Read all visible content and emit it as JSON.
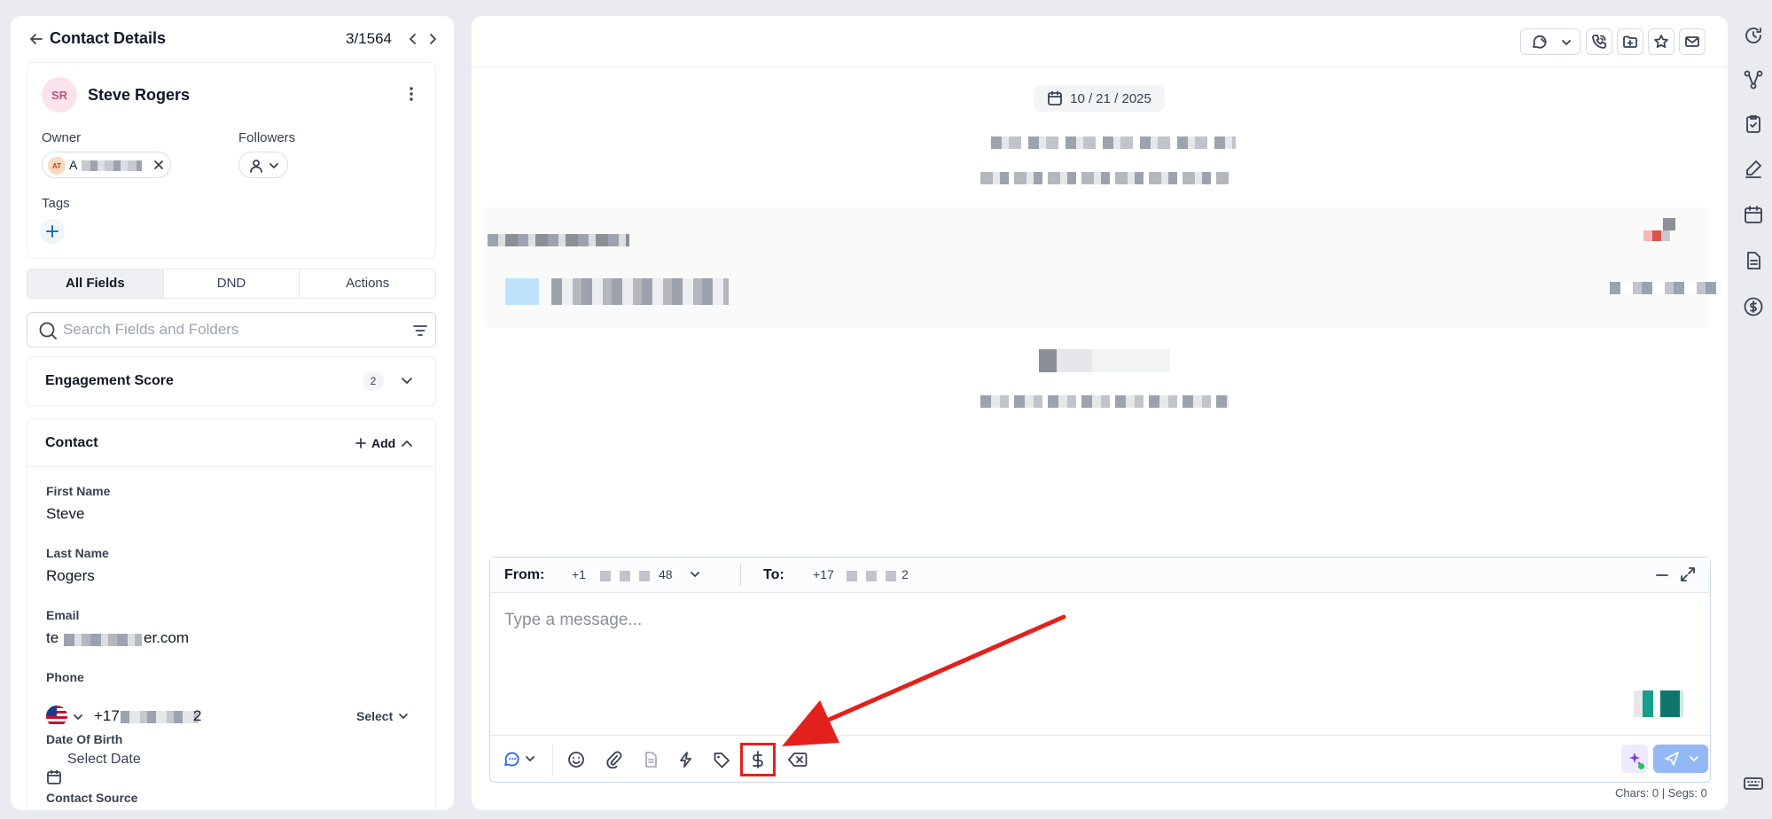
{
  "header": {
    "title": "Contact Details",
    "counter": "3/1564"
  },
  "contact": {
    "initials": "SR",
    "name": "Steve Rogers",
    "owner_label": "Owner",
    "owner_initials": "AT",
    "owner_name": "A",
    "followers_label": "Followers",
    "tags_label": "Tags"
  },
  "tabs": [
    "All Fields",
    "DND",
    "Actions"
  ],
  "search": {
    "placeholder": "Search Fields and Folders"
  },
  "engagement": {
    "title": "Engagement Score",
    "count": "2"
  },
  "contact_section": {
    "title": "Contact",
    "add_label": "Add",
    "first_name_label": "First Name",
    "first_name": "Steve",
    "last_name_label": "Last Name",
    "last_name": "Rogers",
    "email_label": "Email",
    "email_prefix": "te",
    "email_suffix": "er.com",
    "phone_label": "Phone",
    "phone_prefix": "+17",
    "phone_suffix": "2",
    "phone_type_label": "Select",
    "dob_label": "Date Of Birth",
    "dob_placeholder": "Select Date",
    "source_label": "Contact Source"
  },
  "conversation": {
    "date": "10 / 21 / 2025"
  },
  "composer": {
    "from_label": "From:",
    "from_prefix": "+1",
    "from_suffix": "48",
    "to_label": "To:",
    "to_prefix": "+17",
    "to_suffix": "2",
    "placeholder": "Type a message...",
    "counts": "Chars: 0 | Segs: 0"
  },
  "colors": {
    "annotation_red": "#e3211c",
    "send_button": "#93b8f5",
    "avatar_bg": "#fbe3ee"
  }
}
